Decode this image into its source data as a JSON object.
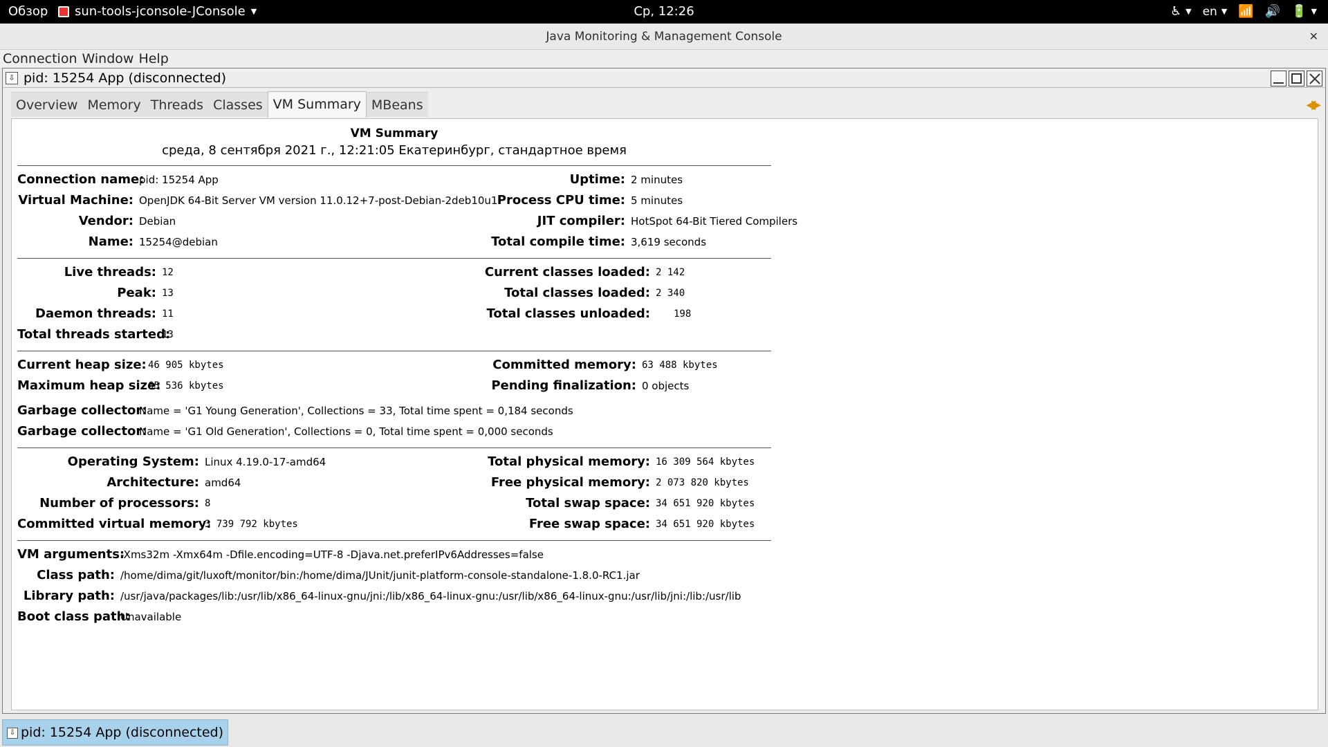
{
  "topbar": {
    "overview": "Обзор",
    "app_name": "sun-tools-jconsole-JConsole",
    "clock": "Ср, 12:26",
    "lang": "en"
  },
  "window": {
    "title": "Java Monitoring & Management Console"
  },
  "menu": {
    "items": [
      {
        "label": "Connection"
      },
      {
        "label": "Window"
      },
      {
        "label": "Help"
      }
    ]
  },
  "frame": {
    "title": "pid: 15254 App (disconnected)"
  },
  "tabs": [
    {
      "label": "Overview",
      "active": false
    },
    {
      "label": "Memory",
      "active": false
    },
    {
      "label": "Threads",
      "active": false
    },
    {
      "label": "Classes",
      "active": false
    },
    {
      "label": "VM Summary",
      "active": true
    },
    {
      "label": "MBeans",
      "active": false
    }
  ],
  "summary": {
    "title": "VM Summary",
    "date": "среда, 8 сентября 2021 г., 12:21:05 Екатеринбург, стандартное время",
    "sec1": {
      "connection_name_label": "Connection name:",
      "connection_name": "pid: 15254 App",
      "uptime_label": "Uptime:",
      "uptime": "2 minutes",
      "vm_label": "Virtual Machine:",
      "vm": "OpenJDK 64-Bit Server VM version 11.0.12+7-post-Debian-2deb10u1",
      "cpu_time_label": "Process CPU time:",
      "cpu_time": "5 minutes",
      "vendor_label": "Vendor:",
      "vendor": "Debian",
      "jit_label": "JIT compiler:",
      "jit": "HotSpot 64-Bit Tiered Compilers",
      "name_label": "Name:",
      "name": "15254@debian",
      "compile_time_label": "Total compile time:",
      "compile_time": "3,619 seconds"
    },
    "sec2": {
      "live_threads_label": "Live threads:",
      "live_threads": "12",
      "current_classes_label": "Current classes loaded:",
      "current_classes": "2 142",
      "peak_label": "Peak:",
      "peak": "13",
      "total_classes_label": "Total classes loaded:",
      "total_classes": "2 340",
      "daemon_label": "Daemon threads:",
      "daemon": "11",
      "unloaded_label": "Total classes unloaded:",
      "unloaded": "198",
      "started_label": "Total threads started:",
      "started": "13"
    },
    "sec3": {
      "heap_label": "Current heap size:",
      "heap": "46 905 kbytes",
      "committed_label": "Committed memory:",
      "committed": "63 488 kbytes",
      "max_heap_label": "Maximum heap size:",
      "max_heap": "65 536 kbytes",
      "pending_label": "Pending finalization:",
      "pending": "0 objects",
      "gc1_label": "Garbage collector:",
      "gc1": "Name = 'G1 Young Generation', Collections = 33, Total time spent = 0,184 seconds",
      "gc2_label": "Garbage collector:",
      "gc2": "Name = 'G1 Old Generation', Collections = 0, Total time spent = 0,000 seconds"
    },
    "sec4": {
      "os_label": "Operating System:",
      "os": "Linux 4.19.0-17-amd64",
      "phys_label": "Total physical memory:",
      "phys": "16 309 564 kbytes",
      "arch_label": "Architecture:",
      "arch": "amd64",
      "free_phys_label": "Free physical memory:",
      "free_phys": "2 073 820 kbytes",
      "cpus_label": "Number of processors:",
      "cpus": "8",
      "swap_label": "Total swap space:",
      "swap": "34 651 920 kbytes",
      "vmem_label": "Committed virtual memory:",
      "vmem": "3 739 792 kbytes",
      "free_swap_label": "Free swap space:",
      "free_swap": "34 651 920 kbytes"
    },
    "sec5": {
      "args_label": "VM arguments:",
      "args": "-Xms32m -Xmx64m -Dfile.encoding=UTF-8 -Djava.net.preferIPv6Addresses=false",
      "cp_label": "Class path:",
      "cp": "/home/dima/git/luxoft/monitor/bin:/home/dima/JUnit/junit-platform-console-standalone-1.8.0-RC1.jar",
      "lib_label": "Library path:",
      "lib": "/usr/java/packages/lib:/usr/lib/x86_64-linux-gnu/jni:/lib/x86_64-linux-gnu:/usr/lib/x86_64-linux-gnu:/usr/lib/jni:/lib:/usr/lib",
      "boot_label": "Boot class path:",
      "boot": "Unavailable"
    }
  },
  "taskbar": {
    "item": "pid: 15254 App (disconnected)"
  }
}
